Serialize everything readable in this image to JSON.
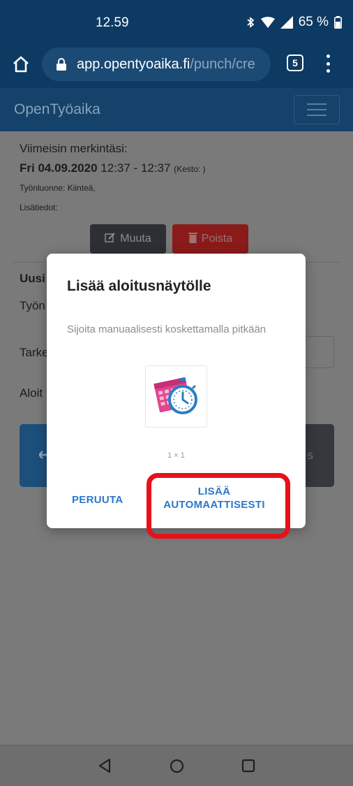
{
  "status_bar": {
    "time": "12.59",
    "battery": "65 %"
  },
  "browser": {
    "url_host": "app.opentyoaika.fi",
    "url_path": "/punch/cre",
    "tab_count": "5"
  },
  "app": {
    "brand": "OpenTyöaika"
  },
  "last_entry": {
    "title": "Viimeisin merkintäsi:",
    "date": "Fri 04.09.2020",
    "time_range": "12:37 - 12:37",
    "duration": "(Kesto: )",
    "work_type": "Työnluonne: Kiinteä,",
    "extra": "Lisätiedot:",
    "edit_label": "Muuta",
    "delete_label": "Poista"
  },
  "new_entry": {
    "title": "Uusi",
    "work_type_label": "Työn",
    "specify_label": "Tarke",
    "start_label": "Aloit",
    "stop_button_suffix": "s"
  },
  "dialog": {
    "title": "Lisää aloitusnäytölle",
    "hint": "Sijoita manuaalisesti koskettamalla pitkään",
    "size": "1 × 1",
    "cancel_label": "PERUUTA",
    "add_label_line1": "LISÄÄ",
    "add_label_line2": "AUTOMAATTISESTI"
  },
  "colors": {
    "status_bg": "#0d3a63",
    "navbar_bg": "#14426a",
    "dialog_accent": "#2a78c8",
    "highlight": "#e8101a",
    "icon_pink": "#e0458f",
    "icon_blue": "#2a7fc4"
  }
}
